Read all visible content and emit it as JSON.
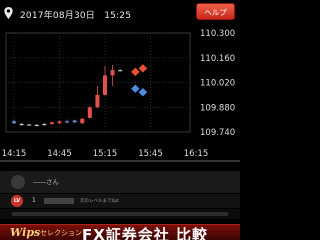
{
  "header": {
    "datetime": "2017年08月30日　15:25",
    "help_label": "ヘルプ"
  },
  "chart_data": {
    "type": "candlestick",
    "title": "",
    "y_ticks": [
      "110.300",
      "110.160",
      "110.020",
      "109.880",
      "109.740"
    ],
    "y_values": [
      110.3,
      110.16,
      110.02,
      109.88,
      109.74
    ],
    "ylim": [
      109.74,
      110.3
    ],
    "x_ticks": [
      "14:15",
      "14:45",
      "15:15",
      "15:45",
      "16:15"
    ],
    "grid": true,
    "candles": [
      {
        "t": "14:15",
        "open": 109.8,
        "close": 109.79,
        "high": 109.81,
        "low": 109.785,
        "color": "#6f8fd8"
      },
      {
        "t": "14:20",
        "open": 109.785,
        "close": 109.785,
        "high": 109.79,
        "low": 109.78,
        "color": "#cccccc"
      },
      {
        "t": "14:25",
        "open": 109.783,
        "close": 109.783,
        "high": 109.785,
        "low": 109.78,
        "color": "#cccccc"
      },
      {
        "t": "14:30",
        "open": 109.78,
        "close": 109.78,
        "high": 109.785,
        "low": 109.775,
        "color": "#cccccc"
      },
      {
        "t": "14:35",
        "open": 109.785,
        "close": 109.785,
        "high": 109.79,
        "low": 109.78,
        "color": "#cccccc"
      },
      {
        "t": "14:40",
        "open": 109.785,
        "close": 109.795,
        "high": 109.8,
        "low": 109.78,
        "color": "#e0524a"
      },
      {
        "t": "14:45",
        "open": 109.79,
        "close": 109.8,
        "high": 109.805,
        "low": 109.785,
        "color": "#e0524a"
      },
      {
        "t": "14:50",
        "open": 109.8,
        "close": 109.8,
        "high": 109.81,
        "low": 109.79,
        "color": "#6f8fd8"
      },
      {
        "t": "14:55",
        "open": 109.805,
        "close": 109.795,
        "high": 109.81,
        "low": 109.79,
        "color": "#6f8fd8"
      },
      {
        "t": "15:00",
        "open": 109.79,
        "close": 109.815,
        "high": 109.82,
        "low": 109.785,
        "color": "#e0524a"
      },
      {
        "t": "15:05",
        "open": 109.82,
        "close": 109.88,
        "high": 109.885,
        "low": 109.815,
        "color": "#e0524a"
      },
      {
        "t": "15:10",
        "open": 109.88,
        "close": 109.95,
        "high": 110.0,
        "low": 109.875,
        "color": "#e0524a"
      },
      {
        "t": "15:15",
        "open": 109.95,
        "close": 110.06,
        "high": 110.115,
        "low": 109.945,
        "color": "#e0524a"
      },
      {
        "t": "15:20",
        "open": 110.06,
        "close": 110.09,
        "high": 110.12,
        "low": 110.0,
        "color": "#e0524a"
      },
      {
        "t": "15:25",
        "open": 110.09,
        "close": 110.09,
        "high": 110.095,
        "low": 110.085,
        "color": "#cccccc"
      }
    ],
    "predictions": [
      {
        "t": "15:35",
        "y": 110.08,
        "direction": "up",
        "color": "#e8502e"
      },
      {
        "t": "15:40",
        "y": 110.1,
        "direction": "up",
        "color": "#e8502e"
      },
      {
        "t": "15:35",
        "y": 109.985,
        "direction": "down",
        "color": "#4a8fe0"
      },
      {
        "t": "15:40",
        "y": 109.965,
        "direction": "down",
        "color": "#4a8fe0"
      }
    ]
  },
  "user": {
    "name": "――さん"
  },
  "level": {
    "icon_text": "LV",
    "value": "1",
    "next_label": "次のレベルまで0pt"
  },
  "banner": {
    "logo": "Wips",
    "sub": "セレクション",
    "main": "FX証券会社 比較"
  },
  "icons": [
    "pin-icon",
    "avatar-icon",
    "level-icon"
  ]
}
